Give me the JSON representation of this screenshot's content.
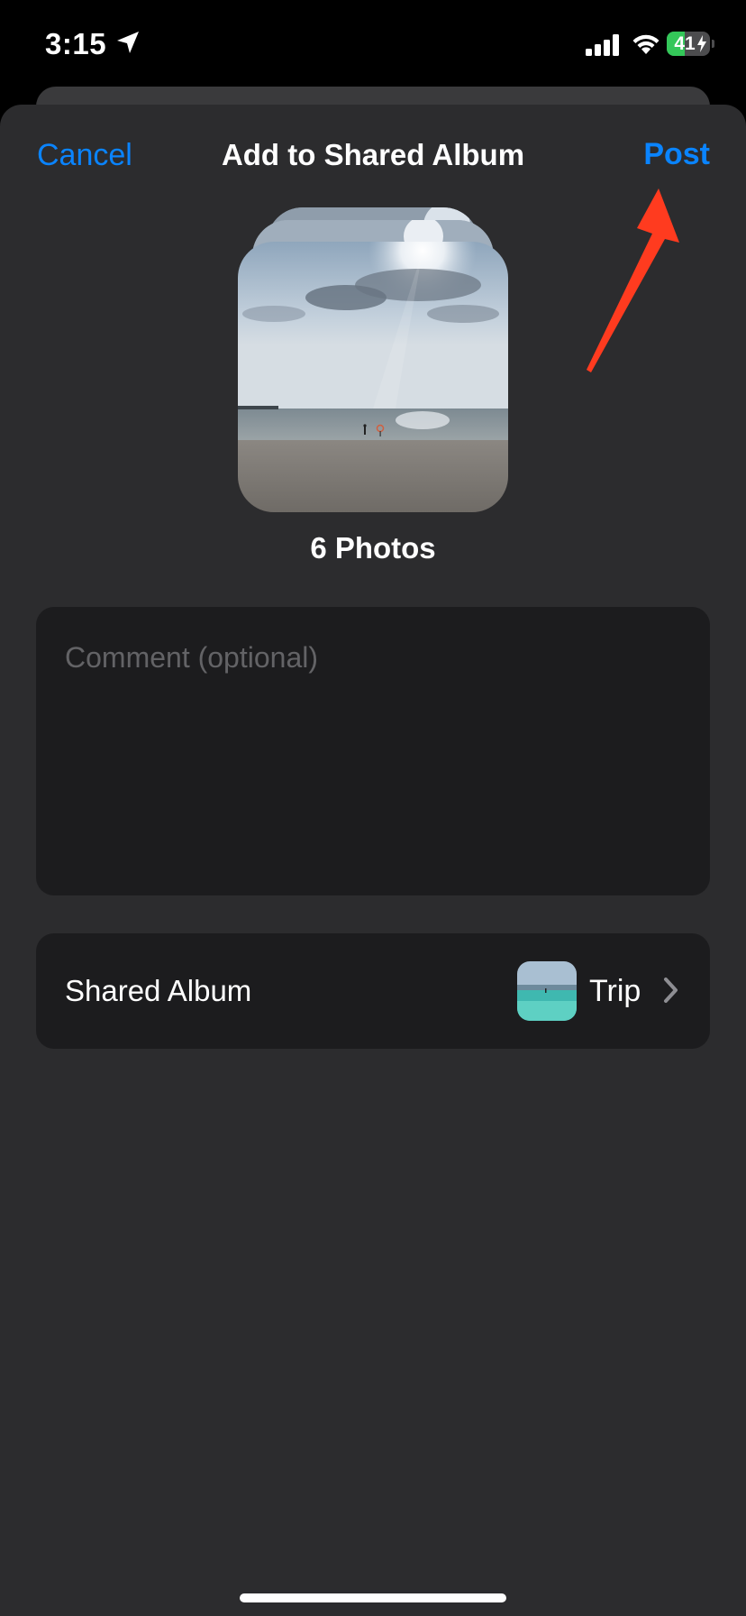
{
  "status_bar": {
    "time": "3:15",
    "battery_percent": "41",
    "battery_level": 0.41,
    "icons": [
      "location-arrow-icon",
      "cellular-signal-icon",
      "wifi-icon",
      "battery-charging-icon"
    ]
  },
  "header": {
    "cancel_label": "Cancel",
    "title": "Add to Shared Album",
    "post_label": "Post"
  },
  "photos": {
    "count_label": "6 Photos"
  },
  "comment": {
    "placeholder": "Comment (optional)",
    "value": ""
  },
  "shared_album": {
    "label": "Shared Album",
    "album_name": "Trip"
  },
  "colors": {
    "accent": "#0a84ff",
    "sheet_bg": "#2c2c2e",
    "cell_bg": "#1c1c1e",
    "annotation": "#ff3b1f"
  }
}
